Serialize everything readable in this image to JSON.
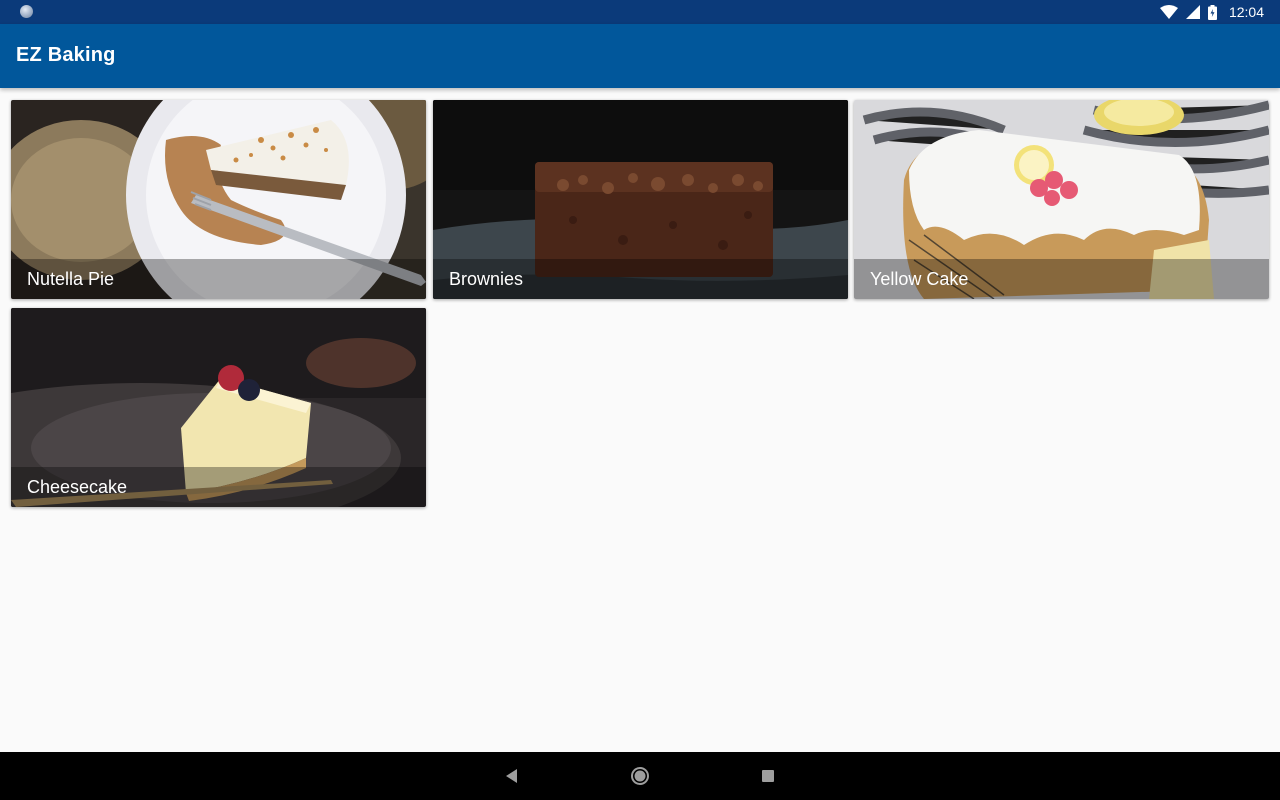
{
  "status_bar": {
    "time": "12:04",
    "icons": [
      "notification-icon",
      "wifi-icon",
      "signal-icon",
      "battery-icon"
    ]
  },
  "app_bar": {
    "title": "EZ Baking",
    "color": "#01579b"
  },
  "recipes": [
    {
      "name": "Nutella Pie"
    },
    {
      "name": "Brownies"
    },
    {
      "name": "Yellow Cake"
    },
    {
      "name": "Cheesecake"
    }
  ],
  "nav_bar": {
    "icons": [
      "back-icon",
      "home-icon",
      "recents-icon"
    ]
  }
}
